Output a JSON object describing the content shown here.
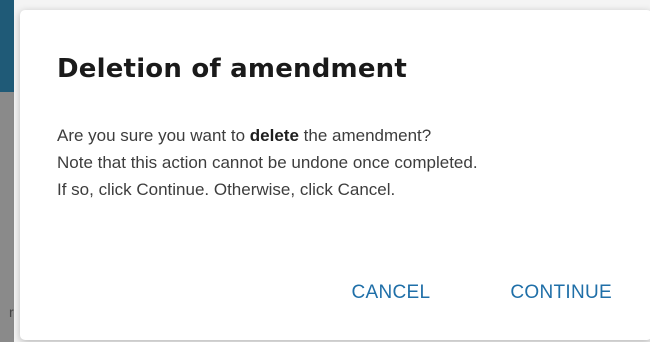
{
  "dialog": {
    "title": "Deletion of amendment",
    "body": {
      "line1_prefix": "Are you sure you want to ",
      "line1_bold": "delete",
      "line1_suffix": " the amendment?",
      "line2": "Note that this action cannot be undone once completed.",
      "line3": "If so, click Continue. Otherwise, click Cancel."
    },
    "actions": {
      "cancel_label": "CANCEL",
      "continue_label": "CONTINUE"
    }
  },
  "background": {
    "partial_letter": "r"
  },
  "colors": {
    "accent": "#1f6fa8",
    "backdrop_strip_top": "#1f5a77",
    "backdrop_strip_rest": "#8a8a8a"
  }
}
